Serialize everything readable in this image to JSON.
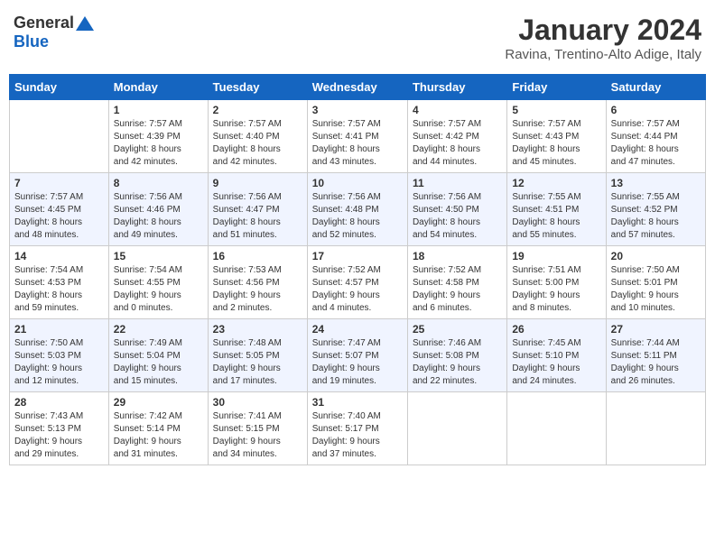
{
  "header": {
    "logo_general": "General",
    "logo_blue": "Blue",
    "month_year": "January 2024",
    "location": "Ravina, Trentino-Alto Adige, Italy"
  },
  "weekdays": [
    "Sunday",
    "Monday",
    "Tuesday",
    "Wednesday",
    "Thursday",
    "Friday",
    "Saturday"
  ],
  "weeks": [
    [
      {
        "day": "",
        "info": ""
      },
      {
        "day": "1",
        "info": "Sunrise: 7:57 AM\nSunset: 4:39 PM\nDaylight: 8 hours\nand 42 minutes."
      },
      {
        "day": "2",
        "info": "Sunrise: 7:57 AM\nSunset: 4:40 PM\nDaylight: 8 hours\nand 42 minutes."
      },
      {
        "day": "3",
        "info": "Sunrise: 7:57 AM\nSunset: 4:41 PM\nDaylight: 8 hours\nand 43 minutes."
      },
      {
        "day": "4",
        "info": "Sunrise: 7:57 AM\nSunset: 4:42 PM\nDaylight: 8 hours\nand 44 minutes."
      },
      {
        "day": "5",
        "info": "Sunrise: 7:57 AM\nSunset: 4:43 PM\nDaylight: 8 hours\nand 45 minutes."
      },
      {
        "day": "6",
        "info": "Sunrise: 7:57 AM\nSunset: 4:44 PM\nDaylight: 8 hours\nand 47 minutes."
      }
    ],
    [
      {
        "day": "7",
        "info": "Sunrise: 7:57 AM\nSunset: 4:45 PM\nDaylight: 8 hours\nand 48 minutes."
      },
      {
        "day": "8",
        "info": "Sunrise: 7:56 AM\nSunset: 4:46 PM\nDaylight: 8 hours\nand 49 minutes."
      },
      {
        "day": "9",
        "info": "Sunrise: 7:56 AM\nSunset: 4:47 PM\nDaylight: 8 hours\nand 51 minutes."
      },
      {
        "day": "10",
        "info": "Sunrise: 7:56 AM\nSunset: 4:48 PM\nDaylight: 8 hours\nand 52 minutes."
      },
      {
        "day": "11",
        "info": "Sunrise: 7:56 AM\nSunset: 4:50 PM\nDaylight: 8 hours\nand 54 minutes."
      },
      {
        "day": "12",
        "info": "Sunrise: 7:55 AM\nSunset: 4:51 PM\nDaylight: 8 hours\nand 55 minutes."
      },
      {
        "day": "13",
        "info": "Sunrise: 7:55 AM\nSunset: 4:52 PM\nDaylight: 8 hours\nand 57 minutes."
      }
    ],
    [
      {
        "day": "14",
        "info": "Sunrise: 7:54 AM\nSunset: 4:53 PM\nDaylight: 8 hours\nand 59 minutes."
      },
      {
        "day": "15",
        "info": "Sunrise: 7:54 AM\nSunset: 4:55 PM\nDaylight: 9 hours\nand 0 minutes."
      },
      {
        "day": "16",
        "info": "Sunrise: 7:53 AM\nSunset: 4:56 PM\nDaylight: 9 hours\nand 2 minutes."
      },
      {
        "day": "17",
        "info": "Sunrise: 7:52 AM\nSunset: 4:57 PM\nDaylight: 9 hours\nand 4 minutes."
      },
      {
        "day": "18",
        "info": "Sunrise: 7:52 AM\nSunset: 4:58 PM\nDaylight: 9 hours\nand 6 minutes."
      },
      {
        "day": "19",
        "info": "Sunrise: 7:51 AM\nSunset: 5:00 PM\nDaylight: 9 hours\nand 8 minutes."
      },
      {
        "day": "20",
        "info": "Sunrise: 7:50 AM\nSunset: 5:01 PM\nDaylight: 9 hours\nand 10 minutes."
      }
    ],
    [
      {
        "day": "21",
        "info": "Sunrise: 7:50 AM\nSunset: 5:03 PM\nDaylight: 9 hours\nand 12 minutes."
      },
      {
        "day": "22",
        "info": "Sunrise: 7:49 AM\nSunset: 5:04 PM\nDaylight: 9 hours\nand 15 minutes."
      },
      {
        "day": "23",
        "info": "Sunrise: 7:48 AM\nSunset: 5:05 PM\nDaylight: 9 hours\nand 17 minutes."
      },
      {
        "day": "24",
        "info": "Sunrise: 7:47 AM\nSunset: 5:07 PM\nDaylight: 9 hours\nand 19 minutes."
      },
      {
        "day": "25",
        "info": "Sunrise: 7:46 AM\nSunset: 5:08 PM\nDaylight: 9 hours\nand 22 minutes."
      },
      {
        "day": "26",
        "info": "Sunrise: 7:45 AM\nSunset: 5:10 PM\nDaylight: 9 hours\nand 24 minutes."
      },
      {
        "day": "27",
        "info": "Sunrise: 7:44 AM\nSunset: 5:11 PM\nDaylight: 9 hours\nand 26 minutes."
      }
    ],
    [
      {
        "day": "28",
        "info": "Sunrise: 7:43 AM\nSunset: 5:13 PM\nDaylight: 9 hours\nand 29 minutes."
      },
      {
        "day": "29",
        "info": "Sunrise: 7:42 AM\nSunset: 5:14 PM\nDaylight: 9 hours\nand 31 minutes."
      },
      {
        "day": "30",
        "info": "Sunrise: 7:41 AM\nSunset: 5:15 PM\nDaylight: 9 hours\nand 34 minutes."
      },
      {
        "day": "31",
        "info": "Sunrise: 7:40 AM\nSunset: 5:17 PM\nDaylight: 9 hours\nand 37 minutes."
      },
      {
        "day": "",
        "info": ""
      },
      {
        "day": "",
        "info": ""
      },
      {
        "day": "",
        "info": ""
      }
    ]
  ]
}
